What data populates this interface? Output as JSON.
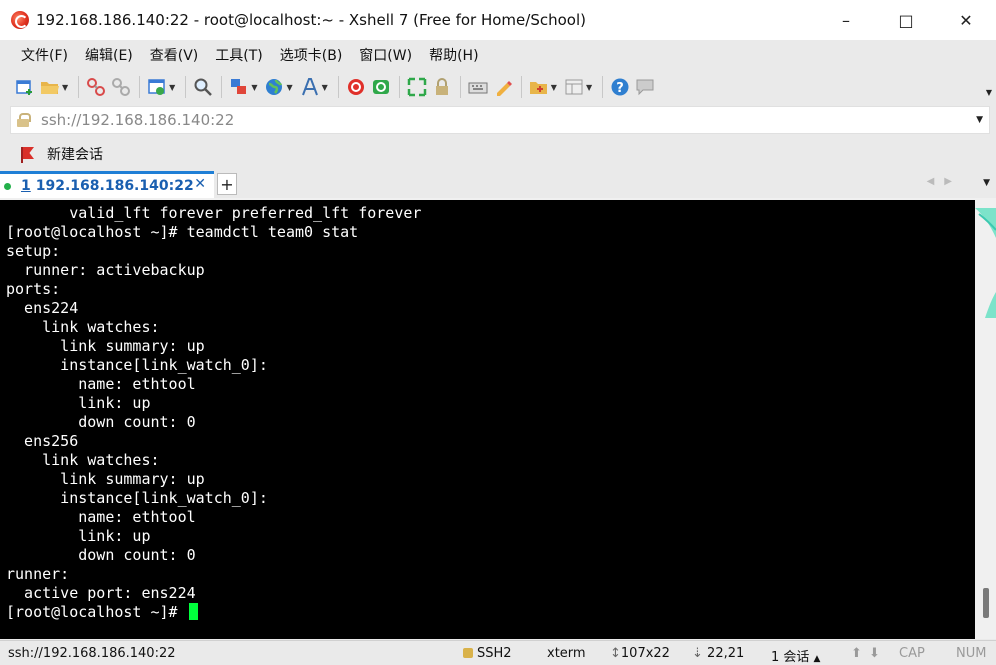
{
  "window": {
    "title": "192.168.186.140:22 - root@localhost:~ - Xshell 7 (Free for Home/School)",
    "minimize": "–",
    "maximize": "□",
    "close": "✕"
  },
  "menu": {
    "items": [
      "文件(F)",
      "编辑(E)",
      "查看(V)",
      "工具(T)",
      "选项卡(B)",
      "窗口(W)",
      "帮助(H)"
    ]
  },
  "toolbar": {
    "icons": [
      "new-session-icon",
      "open-folder-icon",
      "disconnect-icon",
      "reconnect-icon",
      "properties-icon",
      "find-icon",
      "transfer-icon",
      "globe-icon",
      "font-icon",
      "xshell-icon",
      "xftp-icon",
      "fullscreen-icon",
      "lock-icon",
      "keyboard-icon",
      "highlight-icon",
      "script-icon",
      "layout-icon",
      "help-icon",
      "chat-icon"
    ]
  },
  "address": {
    "value": "ssh://192.168.186.140:22"
  },
  "session_bar": {
    "label": "新建会话"
  },
  "tabs": [
    {
      "number": "1",
      "label": "192.168.186.140:22",
      "close": "✕",
      "active": true
    }
  ],
  "tab_add": "+",
  "terminal": {
    "lines": [
      "       valid_lft forever preferred_lft forever",
      "[root@localhost ~]# teamdctl team0 stat",
      "setup:",
      "  runner: activebackup",
      "ports:",
      "  ens224",
      "    link watches:",
      "      link summary: up",
      "      instance[link_watch_0]:",
      "        name: ethtool",
      "        link: up",
      "        down count: 0",
      "  ens256",
      "    link watches:",
      "      link summary: up",
      "      instance[link_watch_0]:",
      "        name: ethtool",
      "        link: up",
      "        down count: 0",
      "runner:",
      "  active port: ens224"
    ],
    "prompt": "[root@localhost ~]# "
  },
  "status": {
    "connection": "ssh://192.168.186.140:22",
    "protocol": "SSH2",
    "term_type": "xterm",
    "size": "107x22",
    "position": "22,21",
    "sessions": "1 会话",
    "caps": "CAP",
    "num": "NUM"
  }
}
